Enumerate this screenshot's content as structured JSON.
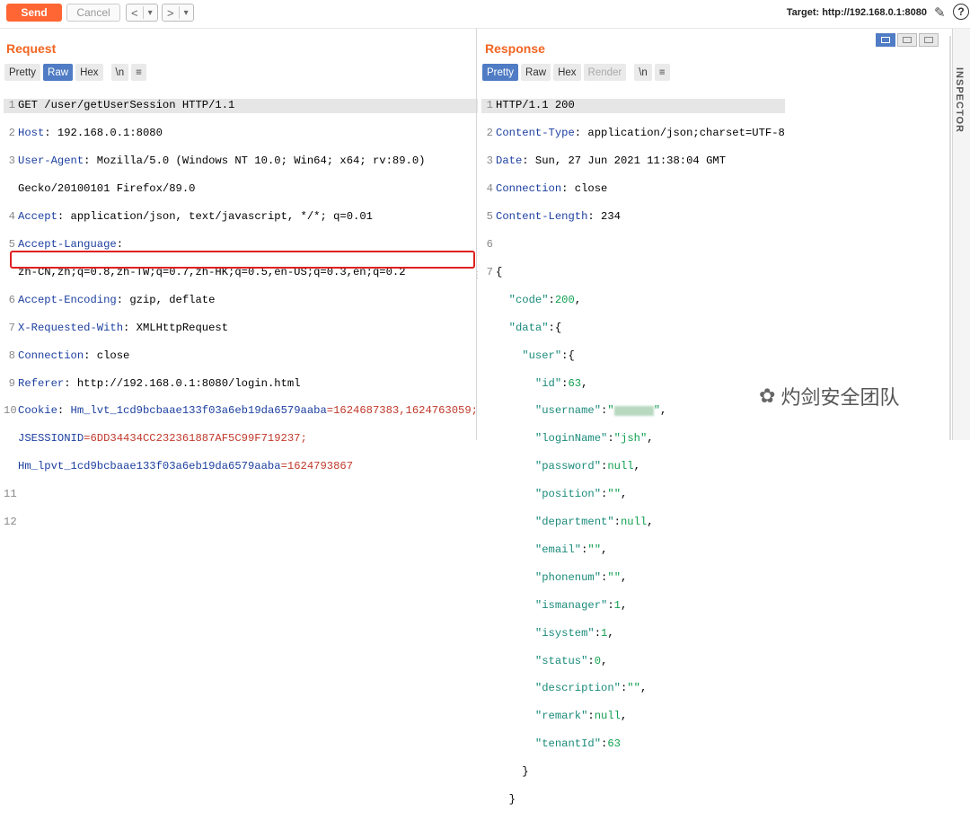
{
  "toolbar": {
    "send_label": "Send",
    "cancel_label": "Cancel",
    "back_label": "<",
    "back_drop": "▾",
    "fwd_label": ">",
    "fwd_drop": "▾",
    "target_label": "Target: http://192.168.0.1:8080",
    "help": "?"
  },
  "request": {
    "title": "Request",
    "tabs": [
      "Pretty",
      "Raw",
      "Hex",
      "\\n",
      "≡"
    ],
    "lines": [
      {
        "n": "1",
        "k": "",
        "v": "GET /user/getUserSession HTTP/1.1"
      },
      {
        "n": "2",
        "k": "Host",
        "v": " 192.168.0.1:8080"
      },
      {
        "n": "3",
        "k": "User-Agent",
        "v": " Mozilla/5.0 (Windows NT 10.0; Win64; x64; rv:89.0)"
      },
      {
        "n": "",
        "k": "",
        "v": "Gecko/20100101 Firefox/89.0"
      },
      {
        "n": "4",
        "k": "Accept",
        "v": " application/json, text/javascript, */*; q=0.01"
      },
      {
        "n": "5",
        "k": "Accept-Language",
        "v": ""
      },
      {
        "n": "",
        "k": "",
        "v": "zh-CN,zh;q=0.8,zh-TW;q=0.7,zh-HK;q=0.5,en-US;q=0.3,en;q=0.2"
      },
      {
        "n": "6",
        "k": "Accept-Encoding",
        "v": " gzip, deflate"
      },
      {
        "n": "7",
        "k": "X-Requested-With",
        "v": " XMLHttpRequest"
      },
      {
        "n": "8",
        "k": "Connection",
        "v": " close"
      },
      {
        "n": "9",
        "k": "Referer",
        "v": " http://192.168.0.1:8080/login.html"
      }
    ],
    "cookie_n": "10",
    "cookie_k": "Cookie",
    "cookie_sep": ": ",
    "cookie_1k": "Hm_lvt_1cd9bcbaae133f03a6eb19da6579aaba",
    "cookie_1v": "=1624687383,1624763059;",
    "cookie_2k": "JSESSIONID",
    "cookie_2v": "=6DD34434CC232361887AF5C99F719237;",
    "cookie_3k": "Hm_lpvt_1cd9bcbaae133f03a6eb19da6579aaba",
    "cookie_3v": "=1624793867",
    "ln11": "11",
    "ln12": "12"
  },
  "response": {
    "title": "Response",
    "tabs": [
      "Pretty",
      "Raw",
      "Hex",
      "Render",
      "\\n",
      "≡"
    ],
    "headers": [
      {
        "n": "1",
        "k": "",
        "v": "HTTP/1.1 200"
      },
      {
        "n": "2",
        "k": "Content-Type",
        "v": " application/json;charset=UTF-8"
      },
      {
        "n": "3",
        "k": "Date",
        "v": " Sun, 27 Jun 2021 11:38:04 GMT"
      },
      {
        "n": "4",
        "k": "Connection",
        "v": " close"
      },
      {
        "n": "5",
        "k": "Content-Length",
        "v": " 234"
      }
    ],
    "ln6": "6",
    "ln7": "7",
    "json": {
      "code": "200",
      "id": "63",
      "loginName": "jsh",
      "password": "null",
      "position": "",
      "department": "null",
      "email": "",
      "phonenum": "",
      "ismanager": "1",
      "isystem": "1",
      "status": "0",
      "description": "",
      "remark": "null",
      "tenantId": "63"
    }
  },
  "inspector": {
    "label": "INSPECTOR"
  },
  "watermark": {
    "text": "灼剑安全团队"
  }
}
